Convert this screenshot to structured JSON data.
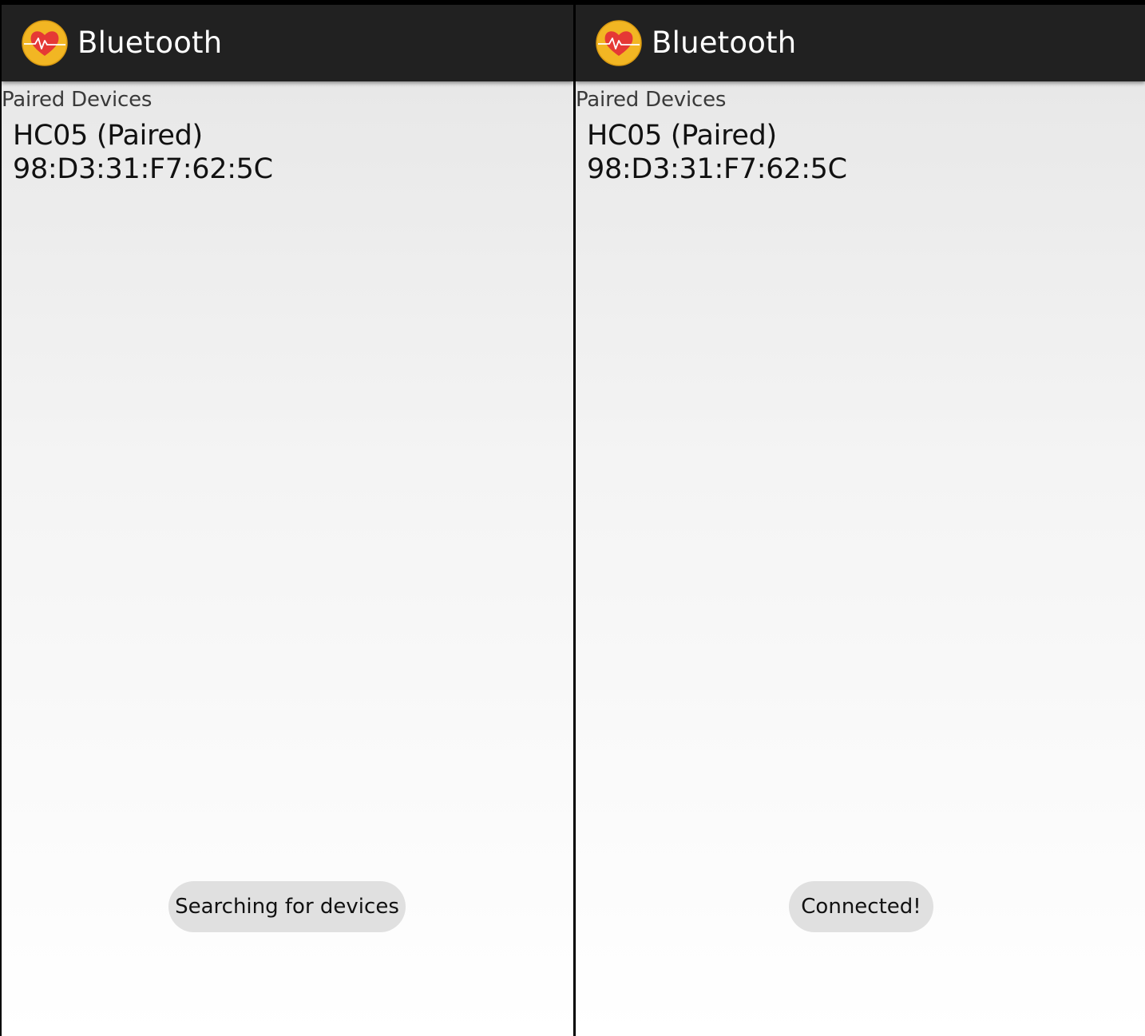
{
  "screens": [
    {
      "appbar": {
        "title": "Bluetooth",
        "icon": "heart-pulse-icon"
      },
      "paired_header": "Paired Devices",
      "devices": [
        {
          "name": "HC05 (Paired)",
          "address": "98:D3:31:F7:62:5C"
        }
      ],
      "toast": "Searching for devices"
    },
    {
      "appbar": {
        "title": "Bluetooth",
        "icon": "heart-pulse-icon"
      },
      "paired_header": "Paired Devices",
      "devices": [
        {
          "name": "HC05 (Paired)",
          "address": "98:D3:31:F7:62:5C"
        }
      ],
      "toast": "Connected!"
    }
  ],
  "colors": {
    "appbar": "#212121",
    "icon_ring": "#f2b623",
    "heart": "#e53935",
    "toast_bg": "#e0e0e0"
  }
}
